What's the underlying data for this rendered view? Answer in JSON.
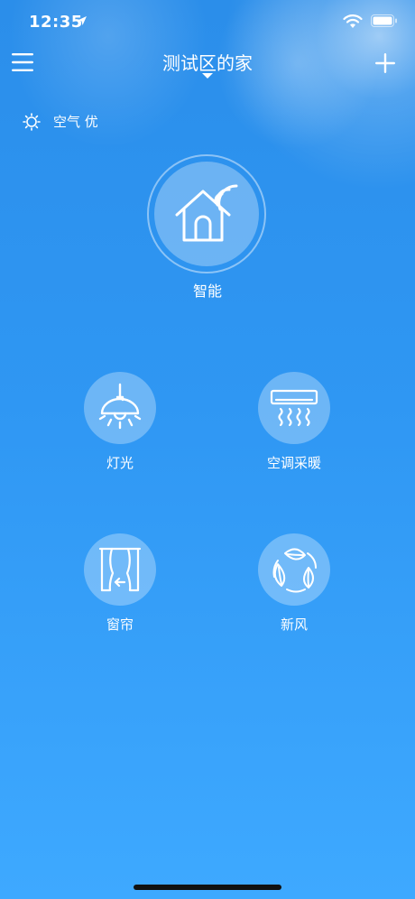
{
  "status_bar": {
    "time": "12:35"
  },
  "header": {
    "title": "测试区的家"
  },
  "air_quality": {
    "label": "空气 优"
  },
  "smart": {
    "label": "智能"
  },
  "devices": [
    {
      "label": "灯光",
      "icon": "lamp-icon"
    },
    {
      "label": "空调采暖",
      "icon": "air-conditioner-icon"
    },
    {
      "label": "窗帘",
      "icon": "curtain-icon"
    },
    {
      "label": "新风",
      "icon": "fresh-air-icon"
    }
  ]
}
